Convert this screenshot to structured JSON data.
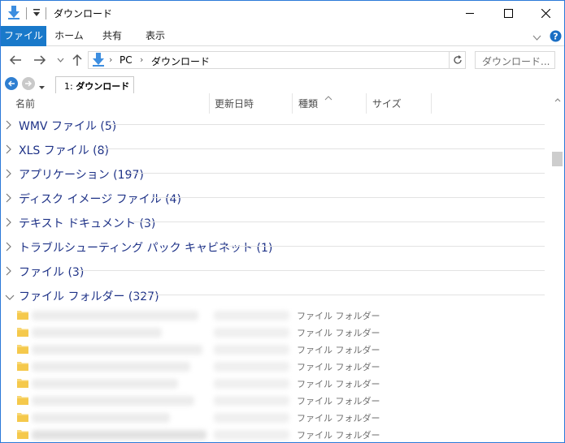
{
  "window": {
    "title": "ダウンロード",
    "controls": [
      "minimize",
      "maximize",
      "close"
    ]
  },
  "ribbon": {
    "tabs": [
      "ファイル",
      "ホーム",
      "共有",
      "表示"
    ]
  },
  "address": {
    "path": [
      "PC",
      "ダウンロード"
    ],
    "search_placeholder": "ダウンロード..."
  },
  "tab_strip": {
    "tab_number": "1:",
    "tab_label": "ダウンロード"
  },
  "columns": [
    "名前",
    "更新日時",
    "種類",
    "サイズ"
  ],
  "groups": [
    {
      "label": "WMV ファイル (5)",
      "expanded": false
    },
    {
      "label": "XLS ファイル (8)",
      "expanded": false
    },
    {
      "label": "アプリケーション (197)",
      "expanded": false
    },
    {
      "label": "ディスク イメージ ファイル (4)",
      "expanded": false
    },
    {
      "label": "テキスト ドキュメント (3)",
      "expanded": false
    },
    {
      "label": "トラブルシューティング パック キャビネット (1)",
      "expanded": false
    },
    {
      "label": "ファイル (3)",
      "expanded": false
    },
    {
      "label": "ファイル フォルダー (327)",
      "expanded": true
    }
  ],
  "folder_rows": [
    {
      "type": "ファイル フォルダー"
    },
    {
      "type": "ファイル フォルダー"
    },
    {
      "type": "ファイル フォルダー"
    },
    {
      "type": "ファイル フォルダー"
    },
    {
      "type": "ファイル フォルダー"
    },
    {
      "type": "ファイル フォルダー"
    },
    {
      "type": "ファイル フォルダー"
    },
    {
      "type": "ファイル フォルダー"
    }
  ],
  "colors": {
    "accent": "#1979ca",
    "group_text": "#1e3287",
    "folder": "#f8d775"
  }
}
